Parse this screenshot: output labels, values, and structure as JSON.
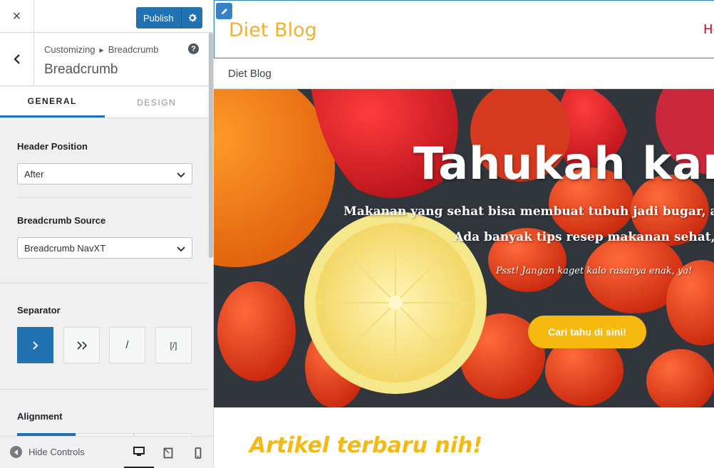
{
  "topbar": {
    "close_icon": "×",
    "publish_label": "Publish"
  },
  "section": {
    "breadcrumb_root": "Customizing",
    "breadcrumb_current": "Breadcrumb",
    "title": "Breadcrumb",
    "help_icon": "?"
  },
  "tabs": [
    {
      "label": "GENERAL",
      "active": true
    },
    {
      "label": "DESIGN",
      "active": false
    }
  ],
  "controls": {
    "header_position": {
      "label": "Header Position",
      "value": "After"
    },
    "breadcrumb_source": {
      "label": "Breadcrumb Source",
      "value": "Breadcrumb NavXT"
    },
    "separator": {
      "label": "Separator",
      "options": [
        {
          "glyph": ">",
          "icon": "chevron-right-icon",
          "active": true
        },
        {
          "glyph": "»",
          "icon": "double-chevron-right-icon",
          "active": false
        },
        {
          "glyph": "/",
          "icon": "slash-icon",
          "active": false
        },
        {
          "glyph": "[/]",
          "icon": "custom-separator-icon",
          "active": false
        }
      ]
    },
    "alignment": {
      "label": "Alignment"
    }
  },
  "footer": {
    "hide_controls_label": "Hide Controls",
    "devices": [
      "desktop",
      "tablet",
      "mobile"
    ]
  },
  "preview": {
    "site_title": "Diet Blog",
    "nav_item": "Ho",
    "breadcrumb": "Diet Blog",
    "hero": {
      "title": "Tahukah kama",
      "line1": "Makanan yang sehat bisa membuat tubuh jadi bugar, awet m",
      "line2": "Ada banyak tips resep makanan sehat, lho",
      "note": "Psst! Jangan kaget kalo rasanya enak, ya!",
      "cta": "Cari tahu di sini!"
    },
    "articles_title": "Artikel terbaru nih!"
  },
  "colors": {
    "wp_blue": "#2271b1",
    "site_title": "#f1b12d",
    "nav_red": "#c0131b",
    "cta_yellow": "#f5b90f"
  }
}
